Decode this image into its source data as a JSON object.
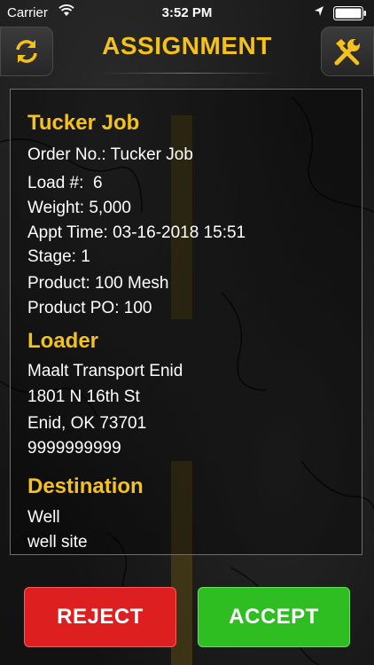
{
  "status_bar": {
    "carrier": "Carrier",
    "time": "3:52 PM"
  },
  "header": {
    "title": "ASSIGNMENT",
    "left_icon": "refresh-icon",
    "right_icon": "tools-icon",
    "accent_color": "#f5c21b"
  },
  "job": {
    "heading": "Tucker Job",
    "order_no": "Order No.: Tucker Job",
    "load": "Load #:  6",
    "weight": "Weight: 5,000",
    "appt_time": "Appt Time: 03-16-2018 15:51",
    "stage": "Stage: 1",
    "product": "Product: 100 Mesh",
    "product_po": "Product PO: 100"
  },
  "loader": {
    "heading": "Loader",
    "name": "Maalt Transport Enid",
    "address": "1801 N 16th St",
    "city": "Enid, OK 73701",
    "phone": "9999999999"
  },
  "destination": {
    "heading": "Destination",
    "name": "Well",
    "site": "well site"
  },
  "actions": {
    "reject_label": "REJECT",
    "reject_color": "#de1f1f",
    "accept_label": "ACCEPT",
    "accept_color": "#2fbe22"
  }
}
